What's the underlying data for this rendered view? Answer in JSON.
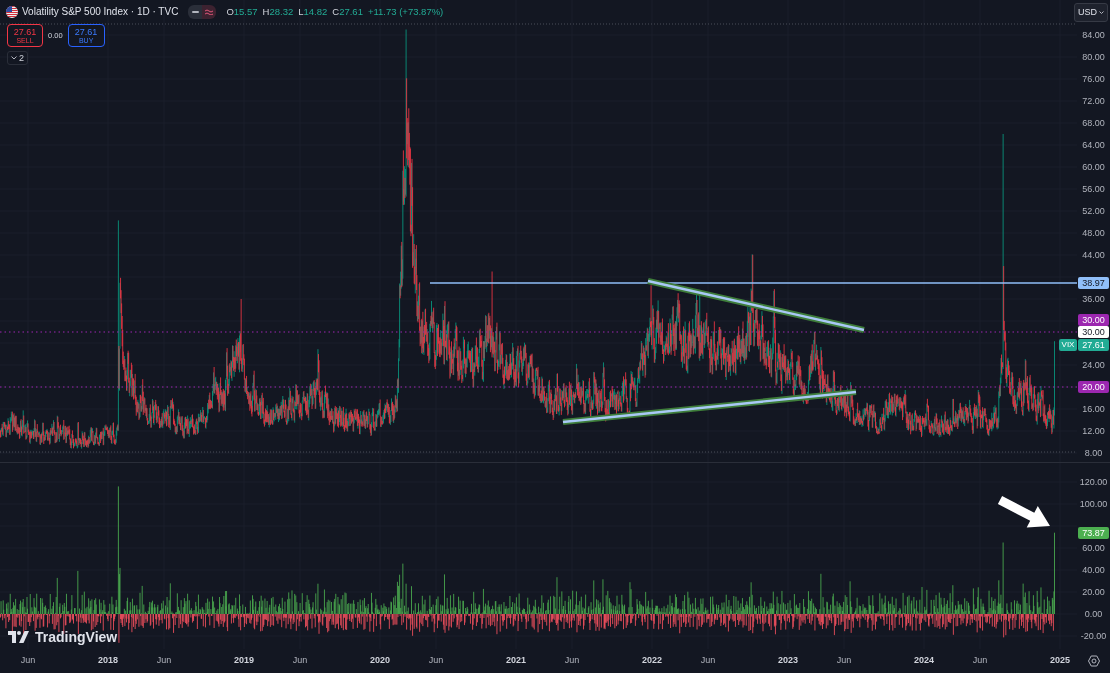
{
  "legend": {
    "title": "Volatility S&P 500 Index · 1D · TVC",
    "ohlc": [
      {
        "key": "O",
        "value": "15.57"
      },
      {
        "key": "H",
        "value": "28.32"
      },
      {
        "key": "L",
        "value": "14.82"
      },
      {
        "key": "C",
        "value": "27.61"
      }
    ],
    "change": "+11.73 (+73.87%)"
  },
  "trade": {
    "sell": {
      "price": "27.61",
      "label": "SELL"
    },
    "spread": "0.00",
    "buy": {
      "price": "27.61",
      "label": "BUY"
    }
  },
  "indicator_toggle": {
    "count": "2"
  },
  "price_scale": {
    "currency": "USD",
    "ticks": [
      "84.00",
      "80.00",
      "76.00",
      "72.00",
      "68.00",
      "64.00",
      "60.00",
      "56.00",
      "52.00",
      "48.00",
      "44.00",
      "36.00",
      "24.00",
      "16.00",
      "12.00",
      "8.00"
    ],
    "markers": [
      {
        "kind": "ray",
        "label": "38.97",
        "color": "#90bff9"
      },
      {
        "kind": "level",
        "label": "30.00",
        "color": "#9c27b0"
      },
      {
        "kind": "plain",
        "label": "30.00",
        "color": "#ffffff"
      },
      {
        "kind": "last",
        "symbol": "VIX",
        "label": "27.61",
        "color": "#22ab94"
      },
      {
        "kind": "level",
        "label": "20.00",
        "color": "#9c27b0"
      }
    ]
  },
  "indicator_scale": {
    "ticks": [
      "120.00",
      "100.00",
      "60.00",
      "40.00",
      "20.00",
      "0.00",
      "-20.00"
    ],
    "markers": [
      {
        "kind": "last",
        "label": "73.87",
        "color": "#4caf50"
      }
    ]
  },
  "time_axis": {
    "labels": [
      {
        "label": "Jun",
        "kind": "month"
      },
      {
        "label": "2018",
        "kind": "year"
      },
      {
        "label": "Jun",
        "kind": "month"
      },
      {
        "label": "2019",
        "kind": "year"
      },
      {
        "label": "Jun",
        "kind": "month"
      },
      {
        "label": "2020",
        "kind": "year"
      },
      {
        "label": "Jun",
        "kind": "month"
      },
      {
        "label": "2021",
        "kind": "year"
      },
      {
        "label": "Jun",
        "kind": "month"
      },
      {
        "label": "2022",
        "kind": "year"
      },
      {
        "label": "Jun",
        "kind": "month"
      },
      {
        "label": "2023",
        "kind": "year"
      },
      {
        "label": "Jun",
        "kind": "month"
      },
      {
        "label": "2024",
        "kind": "year"
      },
      {
        "label": "Jun",
        "kind": "month"
      },
      {
        "label": "2025",
        "kind": "year"
      }
    ]
  },
  "branding": {
    "name": "TradingView"
  }
}
